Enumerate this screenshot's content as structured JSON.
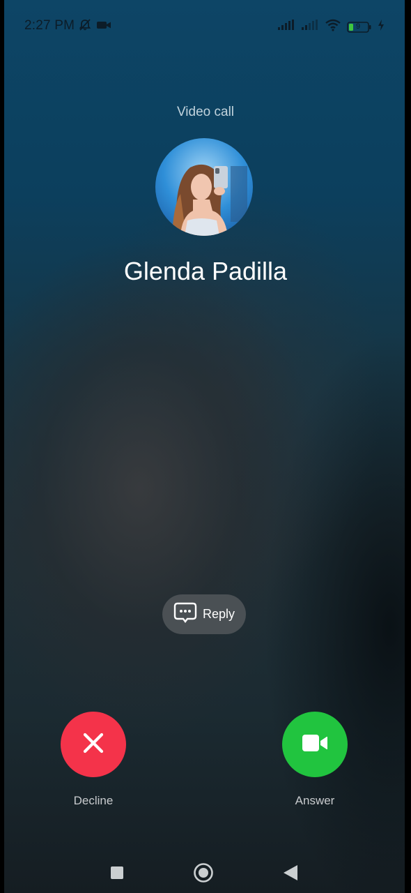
{
  "status_bar": {
    "time": "2:27 PM",
    "battery_level": "9"
  },
  "call": {
    "type_label": "Video call",
    "caller_name": "Glenda Padilla"
  },
  "reply": {
    "label": "Reply"
  },
  "actions": {
    "decline_label": "Decline",
    "answer_label": "Answer"
  },
  "colors": {
    "decline": "#f4334a",
    "answer": "#21c43f"
  },
  "icons": {
    "status_left": [
      "mute-notification-icon",
      "video-camera-icon"
    ],
    "status_right": [
      "signal-strength-icon",
      "signal-strength-2-icon",
      "wifi-icon",
      "battery-icon",
      "charging-icon"
    ],
    "nav": [
      "recents-square-icon",
      "home-circle-icon",
      "back-triangle-icon"
    ]
  }
}
